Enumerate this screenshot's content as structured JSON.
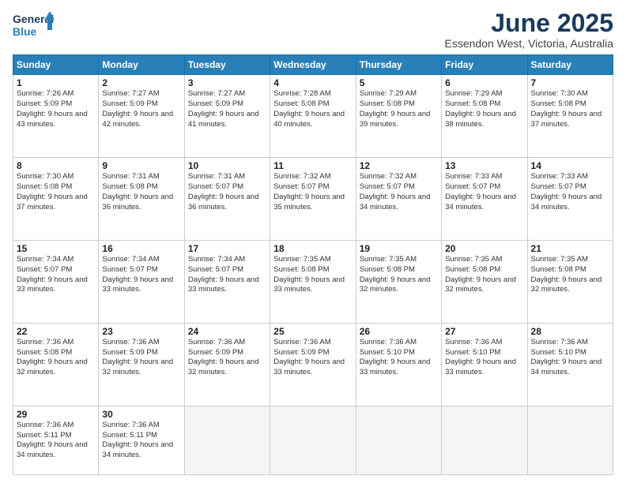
{
  "logo": {
    "text_general": "General",
    "text_blue": "Blue"
  },
  "title": {
    "month": "June 2025",
    "location": "Essendon West, Victoria, Australia"
  },
  "weekdays": [
    "Sunday",
    "Monday",
    "Tuesday",
    "Wednesday",
    "Thursday",
    "Friday",
    "Saturday"
  ],
  "weeks": [
    [
      {
        "day": "1",
        "sunrise": "Sunrise: 7:26 AM",
        "sunset": "Sunset: 5:09 PM",
        "daylight": "Daylight: 9 hours and 43 minutes."
      },
      {
        "day": "2",
        "sunrise": "Sunrise: 7:27 AM",
        "sunset": "Sunset: 5:09 PM",
        "daylight": "Daylight: 9 hours and 42 minutes."
      },
      {
        "day": "3",
        "sunrise": "Sunrise: 7:27 AM",
        "sunset": "Sunset: 5:09 PM",
        "daylight": "Daylight: 9 hours and 41 minutes."
      },
      {
        "day": "4",
        "sunrise": "Sunrise: 7:28 AM",
        "sunset": "Sunset: 5:08 PM",
        "daylight": "Daylight: 9 hours and 40 minutes."
      },
      {
        "day": "5",
        "sunrise": "Sunrise: 7:29 AM",
        "sunset": "Sunset: 5:08 PM",
        "daylight": "Daylight: 9 hours and 39 minutes."
      },
      {
        "day": "6",
        "sunrise": "Sunrise: 7:29 AM",
        "sunset": "Sunset: 5:08 PM",
        "daylight": "Daylight: 9 hours and 38 minutes."
      },
      {
        "day": "7",
        "sunrise": "Sunrise: 7:30 AM",
        "sunset": "Sunset: 5:08 PM",
        "daylight": "Daylight: 9 hours and 37 minutes."
      }
    ],
    [
      {
        "day": "8",
        "sunrise": "Sunrise: 7:30 AM",
        "sunset": "Sunset: 5:08 PM",
        "daylight": "Daylight: 9 hours and 37 minutes."
      },
      {
        "day": "9",
        "sunrise": "Sunrise: 7:31 AM",
        "sunset": "Sunset: 5:08 PM",
        "daylight": "Daylight: 9 hours and 36 minutes."
      },
      {
        "day": "10",
        "sunrise": "Sunrise: 7:31 AM",
        "sunset": "Sunset: 5:07 PM",
        "daylight": "Daylight: 9 hours and 36 minutes."
      },
      {
        "day": "11",
        "sunrise": "Sunrise: 7:32 AM",
        "sunset": "Sunset: 5:07 PM",
        "daylight": "Daylight: 9 hours and 35 minutes."
      },
      {
        "day": "12",
        "sunrise": "Sunrise: 7:32 AM",
        "sunset": "Sunset: 5:07 PM",
        "daylight": "Daylight: 9 hours and 34 minutes."
      },
      {
        "day": "13",
        "sunrise": "Sunrise: 7:33 AM",
        "sunset": "Sunset: 5:07 PM",
        "daylight": "Daylight: 9 hours and 34 minutes."
      },
      {
        "day": "14",
        "sunrise": "Sunrise: 7:33 AM",
        "sunset": "Sunset: 5:07 PM",
        "daylight": "Daylight: 9 hours and 34 minutes."
      }
    ],
    [
      {
        "day": "15",
        "sunrise": "Sunrise: 7:34 AM",
        "sunset": "Sunset: 5:07 PM",
        "daylight": "Daylight: 9 hours and 33 minutes."
      },
      {
        "day": "16",
        "sunrise": "Sunrise: 7:34 AM",
        "sunset": "Sunset: 5:07 PM",
        "daylight": "Daylight: 9 hours and 33 minutes."
      },
      {
        "day": "17",
        "sunrise": "Sunrise: 7:34 AM",
        "sunset": "Sunset: 5:07 PM",
        "daylight": "Daylight: 9 hours and 33 minutes."
      },
      {
        "day": "18",
        "sunrise": "Sunrise: 7:35 AM",
        "sunset": "Sunset: 5:08 PM",
        "daylight": "Daylight: 9 hours and 33 minutes."
      },
      {
        "day": "19",
        "sunrise": "Sunrise: 7:35 AM",
        "sunset": "Sunset: 5:08 PM",
        "daylight": "Daylight: 9 hours and 32 minutes."
      },
      {
        "day": "20",
        "sunrise": "Sunrise: 7:35 AM",
        "sunset": "Sunset: 5:08 PM",
        "daylight": "Daylight: 9 hours and 32 minutes."
      },
      {
        "day": "21",
        "sunrise": "Sunrise: 7:35 AM",
        "sunset": "Sunset: 5:08 PM",
        "daylight": "Daylight: 9 hours and 32 minutes."
      }
    ],
    [
      {
        "day": "22",
        "sunrise": "Sunrise: 7:36 AM",
        "sunset": "Sunset: 5:08 PM",
        "daylight": "Daylight: 9 hours and 32 minutes."
      },
      {
        "day": "23",
        "sunrise": "Sunrise: 7:36 AM",
        "sunset": "Sunset: 5:09 PM",
        "daylight": "Daylight: 9 hours and 32 minutes."
      },
      {
        "day": "24",
        "sunrise": "Sunrise: 7:36 AM",
        "sunset": "Sunset: 5:09 PM",
        "daylight": "Daylight: 9 hours and 32 minutes."
      },
      {
        "day": "25",
        "sunrise": "Sunrise: 7:36 AM",
        "sunset": "Sunset: 5:09 PM",
        "daylight": "Daylight: 9 hours and 33 minutes."
      },
      {
        "day": "26",
        "sunrise": "Sunrise: 7:36 AM",
        "sunset": "Sunset: 5:10 PM",
        "daylight": "Daylight: 9 hours and 33 minutes."
      },
      {
        "day": "27",
        "sunrise": "Sunrise: 7:36 AM",
        "sunset": "Sunset: 5:10 PM",
        "daylight": "Daylight: 9 hours and 33 minutes."
      },
      {
        "day": "28",
        "sunrise": "Sunrise: 7:36 AM",
        "sunset": "Sunset: 5:10 PM",
        "daylight": "Daylight: 9 hours and 34 minutes."
      }
    ],
    [
      {
        "day": "29",
        "sunrise": "Sunrise: 7:36 AM",
        "sunset": "Sunset: 5:11 PM",
        "daylight": "Daylight: 9 hours and 34 minutes."
      },
      {
        "day": "30",
        "sunrise": "Sunrise: 7:36 AM",
        "sunset": "Sunset: 5:11 PM",
        "daylight": "Daylight: 9 hours and 34 minutes."
      },
      {
        "day": "",
        "sunrise": "",
        "sunset": "",
        "daylight": ""
      },
      {
        "day": "",
        "sunrise": "",
        "sunset": "",
        "daylight": ""
      },
      {
        "day": "",
        "sunrise": "",
        "sunset": "",
        "daylight": ""
      },
      {
        "day": "",
        "sunrise": "",
        "sunset": "",
        "daylight": ""
      },
      {
        "day": "",
        "sunrise": "",
        "sunset": "",
        "daylight": ""
      }
    ]
  ]
}
